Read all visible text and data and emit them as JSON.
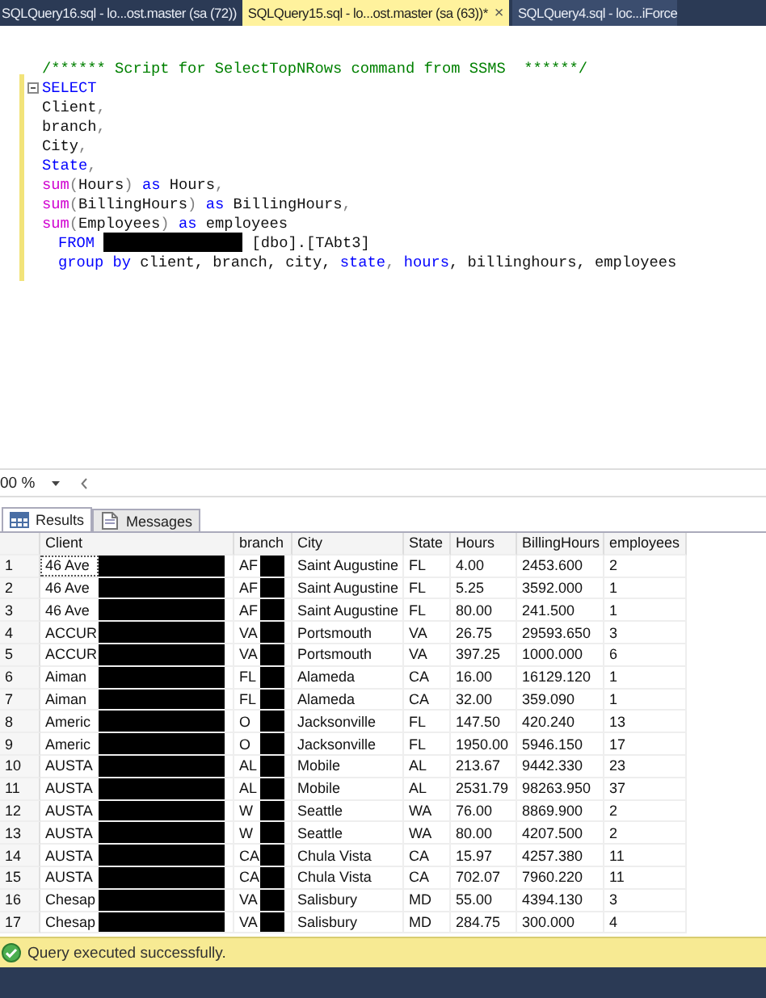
{
  "tabs": [
    {
      "label": "SQLQuery16.sql - lo...ost.master (sa (72))",
      "selected": false
    },
    {
      "label": "SQLQuery15.sql - lo...ost.master (sa (63))*",
      "selected": true,
      "close": "×"
    },
    {
      "label": "SQLQuery4.sql - loc...iForce",
      "selected": false
    }
  ],
  "editor": {
    "lines": [
      {
        "collapsible": false,
        "indented": false,
        "tokens": [
          {
            "kind": "comment",
            "text": "/****** Script for SelectTopNRows command from SSMS  ******/"
          }
        ]
      },
      {
        "collapsible": true,
        "indented": false,
        "tokens": [
          {
            "kind": "keyword",
            "text": "SELECT"
          }
        ]
      },
      {
        "collapsible": false,
        "indented": false,
        "tokens": [
          {
            "kind": "plain",
            "text": "Client"
          },
          {
            "kind": "operator",
            "text": ","
          }
        ]
      },
      {
        "collapsible": false,
        "indented": false,
        "tokens": [
          {
            "kind": "plain",
            "text": "branch"
          },
          {
            "kind": "operator",
            "text": ","
          }
        ]
      },
      {
        "collapsible": false,
        "indented": false,
        "tokens": [
          {
            "kind": "plain",
            "text": "City"
          },
          {
            "kind": "operator",
            "text": ","
          }
        ]
      },
      {
        "collapsible": false,
        "indented": false,
        "tokens": [
          {
            "kind": "keyword",
            "text": "State"
          },
          {
            "kind": "operator",
            "text": ","
          }
        ]
      },
      {
        "collapsible": false,
        "indented": false,
        "tokens": [
          {
            "kind": "function",
            "text": "sum"
          },
          {
            "kind": "operator",
            "text": "("
          },
          {
            "kind": "plain",
            "text": "Hours"
          },
          {
            "kind": "operator",
            "text": ")"
          },
          {
            "kind": "keyword",
            "text": " as "
          },
          {
            "kind": "plain",
            "text": "Hours"
          },
          {
            "kind": "operator",
            "text": ","
          }
        ]
      },
      {
        "collapsible": false,
        "indented": false,
        "tokens": [
          {
            "kind": "function",
            "text": "sum"
          },
          {
            "kind": "operator",
            "text": "("
          },
          {
            "kind": "plain",
            "text": "BillingHours"
          },
          {
            "kind": "operator",
            "text": ")"
          },
          {
            "kind": "keyword",
            "text": " as "
          },
          {
            "kind": "plain",
            "text": "BillingHours"
          },
          {
            "kind": "operator",
            "text": ","
          }
        ]
      },
      {
        "collapsible": false,
        "indented": false,
        "tokens": [
          {
            "kind": "function",
            "text": "sum"
          },
          {
            "kind": "operator",
            "text": "("
          },
          {
            "kind": "plain",
            "text": "Employees"
          },
          {
            "kind": "operator",
            "text": ")"
          },
          {
            "kind": "keyword",
            "text": " as "
          },
          {
            "kind": "plain",
            "text": "employees"
          }
        ]
      },
      {
        "collapsible": false,
        "indented": true,
        "tokens": [
          {
            "kind": "keyword",
            "text": "FROM "
          },
          {
            "kind": "redacted"
          },
          {
            "kind": "plain",
            "text": " [dbo].[TAbt3]"
          }
        ]
      },
      {
        "collapsible": false,
        "indented": true,
        "tokens": [
          {
            "kind": "keyword",
            "text": "group by"
          },
          {
            "kind": "plain",
            "text": " client, branch, city, "
          },
          {
            "kind": "keyword",
            "text": "state"
          },
          {
            "kind": "operator",
            "text": ", "
          },
          {
            "kind": "keyword",
            "text": "hours"
          },
          {
            "kind": "plain",
            "text": ", billinghours, employees"
          }
        ]
      }
    ]
  },
  "zoom": {
    "value": "00 %"
  },
  "result_tabs": [
    {
      "label": "Results",
      "kind": "grid",
      "selected": true
    },
    {
      "label": "Messages",
      "kind": "document",
      "selected": false
    }
  ],
  "grid": {
    "columns": [
      {
        "label": "Client",
        "redacted": true
      },
      {
        "label": "branch",
        "redacted": true
      },
      {
        "label": "City",
        "redacted": false
      },
      {
        "label": "State",
        "redacted": false
      },
      {
        "label": "Hours",
        "redacted": false
      },
      {
        "label": "BillingHours",
        "redacted": false
      },
      {
        "label": "employees",
        "redacted": false
      }
    ],
    "rows": [
      {
        "number": "1",
        "selected": true,
        "cells": [
          "46 Ave",
          "AF",
          "Saint Augustine",
          "FL",
          "4.00",
          "2453.600",
          "2"
        ]
      },
      {
        "number": "2",
        "selected": false,
        "cells": [
          "46 Ave",
          "AF",
          "Saint Augustine",
          "FL",
          "5.25",
          "3592.000",
          "1"
        ]
      },
      {
        "number": "3",
        "selected": false,
        "cells": [
          "46 Ave",
          "AF",
          "Saint Augustine",
          "FL",
          "80.00",
          "241.500",
          "1"
        ]
      },
      {
        "number": "4",
        "selected": false,
        "cells": [
          "ACCUR",
          "VA",
          "Portsmouth",
          "VA",
          "26.75",
          "29593.650",
          "3"
        ]
      },
      {
        "number": "5",
        "selected": false,
        "cells": [
          "ACCUR",
          "VA",
          "Portsmouth",
          "VA",
          "397.25",
          "1000.000",
          "6"
        ]
      },
      {
        "number": "6",
        "selected": false,
        "cells": [
          "Aiman",
          "FL",
          "Alameda",
          "CA",
          "16.00",
          "16129.120",
          "1"
        ]
      },
      {
        "number": "7",
        "selected": false,
        "cells": [
          "Aiman",
          "FL",
          "Alameda",
          "CA",
          "32.00",
          "359.090",
          "1"
        ]
      },
      {
        "number": "8",
        "selected": false,
        "cells": [
          "Americ",
          "O",
          "Jacksonville",
          "FL",
          "147.50",
          "420.240",
          "13"
        ]
      },
      {
        "number": "9",
        "selected": false,
        "cells": [
          "Americ",
          "O",
          "Jacksonville",
          "FL",
          "1950.00",
          "5946.150",
          "17"
        ]
      },
      {
        "number": "10",
        "selected": false,
        "cells": [
          "AUSTA",
          "AL",
          "Mobile",
          "AL",
          "213.67",
          "9442.330",
          "23"
        ]
      },
      {
        "number": "11",
        "selected": false,
        "cells": [
          "AUSTA",
          "AL",
          "Mobile",
          "AL",
          "2531.79",
          "98263.950",
          "37"
        ]
      },
      {
        "number": "12",
        "selected": false,
        "cells": [
          "AUSTA",
          "W",
          "Seattle",
          "WA",
          "76.00",
          "8869.900",
          "2"
        ]
      },
      {
        "number": "13",
        "selected": false,
        "cells": [
          "AUSTA",
          "W",
          "Seattle",
          "WA",
          "80.00",
          "4207.500",
          "2"
        ]
      },
      {
        "number": "14",
        "selected": false,
        "cells": [
          "AUSTA",
          "CA",
          "Chula Vista",
          "CA",
          "15.97",
          "4257.380",
          "11"
        ]
      },
      {
        "number": "15",
        "selected": false,
        "cells": [
          "AUSTA",
          "CA",
          "Chula Vista",
          "CA",
          "702.07",
          "7960.220",
          "11"
        ]
      },
      {
        "number": "16",
        "selected": false,
        "cells": [
          "Chesap",
          "VA",
          "Salisbury",
          "MD",
          "55.00",
          "4394.130",
          "3"
        ]
      },
      {
        "number": "17",
        "selected": false,
        "cells": [
          "Chesap",
          "VA",
          "Salisbury",
          "MD",
          "284.75",
          "300.000",
          "4"
        ]
      }
    ]
  },
  "status_bar": {
    "kind": "success",
    "text": "Query executed successfully."
  }
}
